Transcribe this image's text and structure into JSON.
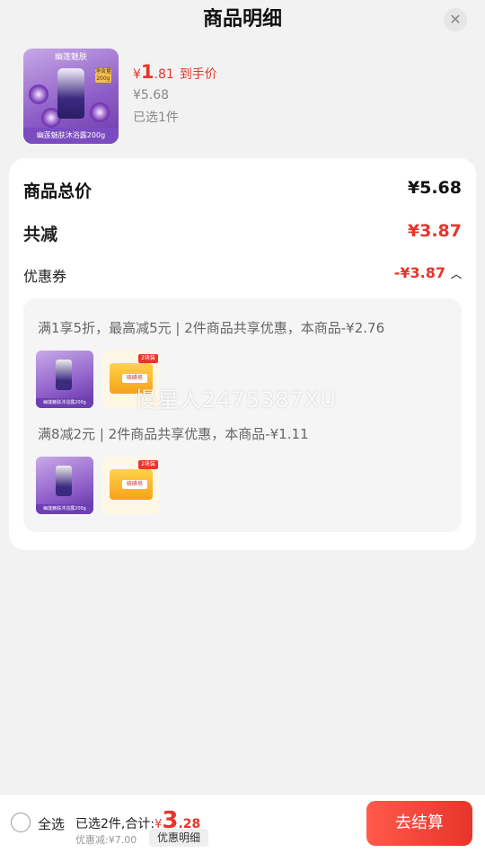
{
  "header": {
    "title": "商品明细",
    "close_icon": "close-icon"
  },
  "product": {
    "thumb_brand": "幽莲魅肤",
    "thumb_caption": "幽莲魅肤沐浴露200g",
    "thumb_weight": "净含量200g",
    "final_price_prefix": "¥",
    "final_price_int": "1",
    "final_price_dec": ".81",
    "final_price_tag": "到手价",
    "original_price": "¥5.68",
    "selected": "已选1件"
  },
  "summary": {
    "total_label": "商品总价",
    "total_value": "¥5.68",
    "reduce_label": "共减",
    "reduce_value": "¥3.87",
    "coupon_label": "优惠券",
    "coupon_value": "-¥3.87"
  },
  "promotions": [
    {
      "text": "满1享5折，最高减5元 | 2件商品共享优惠，本商品-¥2.76"
    },
    {
      "text": "满8减2元 | 2件商品共享优惠，本商品-¥1.11"
    }
  ],
  "mini_items": {
    "purple_caption": "幽莲魅肤沐浴露200g",
    "soap_label": "硫磺皂",
    "soap_tag": "2块装"
  },
  "watermark": "慢星人2475387XU",
  "bottom_bar": {
    "select_all": "全选",
    "summary_prefix": "已选2件,合计:",
    "total_yen": "¥",
    "total_int": "3",
    "total_dec": ".28",
    "discount": "优惠减:¥7.00",
    "detail_button": "优惠明细",
    "checkout_button": "去结算"
  },
  "colors": {
    "accent": "#e8342b",
    "background": "#f2f2f2"
  }
}
